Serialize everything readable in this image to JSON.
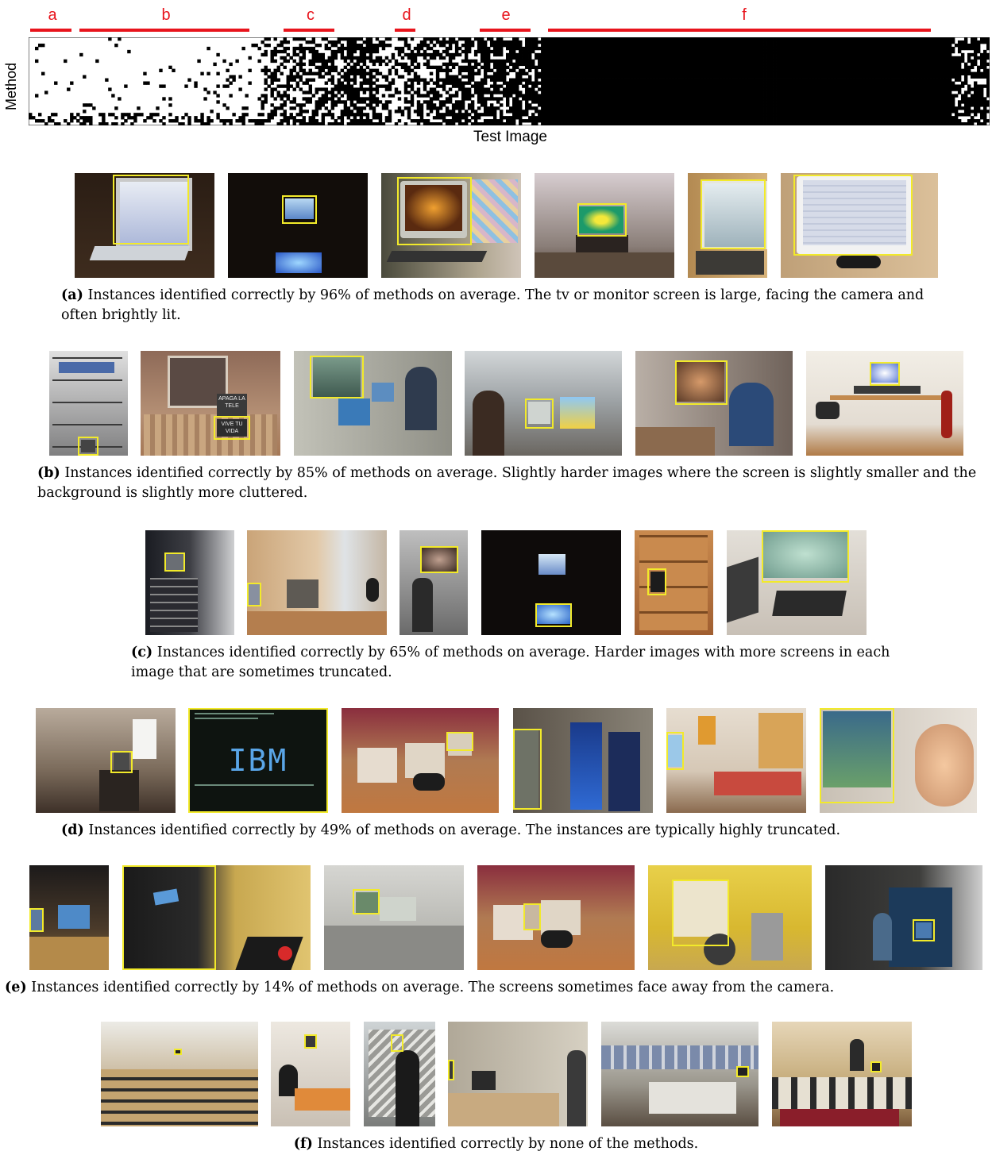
{
  "heatmap": {
    "xlabel": "Test Image",
    "ylabel": "Method",
    "segments": [
      {
        "label": "a"
      },
      {
        "label": "b"
      },
      {
        "label": "c"
      },
      {
        "label": "d"
      },
      {
        "label": "e"
      },
      {
        "label": "f"
      }
    ],
    "colors": {
      "segment": "#e8141c",
      "fill": "#000000",
      "background": "#ffffff"
    }
  },
  "panels": [
    {
      "tag": "(a)",
      "text": "Instances identified correctly by 96% of methods on average. The tv or monitor screen is large, facing the camera and often brightly lit.",
      "image_count": 6
    },
    {
      "tag": "(b)",
      "text": "Instances identified correctly by 85% of methods on average. Slightly harder images where the screen is slightly smaller and the background is slightly more cluttered.",
      "image_count": 6
    },
    {
      "tag": "(c)",
      "text": "Instances identified correctly by 65% of methods on average. Harder images with more screens in each image that are sometimes truncated.",
      "image_count": 6
    },
    {
      "tag": "(d)",
      "text": "Instances identified correctly by 49% of methods on average. The instances are typically highly truncated.",
      "image_count": 6
    },
    {
      "tag": "(e)",
      "text": "Instances identified correctly by 14% of methods on average. The screens sometimes face away from the camera.",
      "image_count": 6
    },
    {
      "tag": "(f)",
      "text": "Instances identified correctly by none of the methods.",
      "image_count": 6
    }
  ],
  "photo_text": {
    "ibm_logo": "IBM",
    "sign_1": "APAGA LA TELE",
    "sign_2": "VIVE TU VIDA"
  },
  "box_color": "#f2ea2a"
}
